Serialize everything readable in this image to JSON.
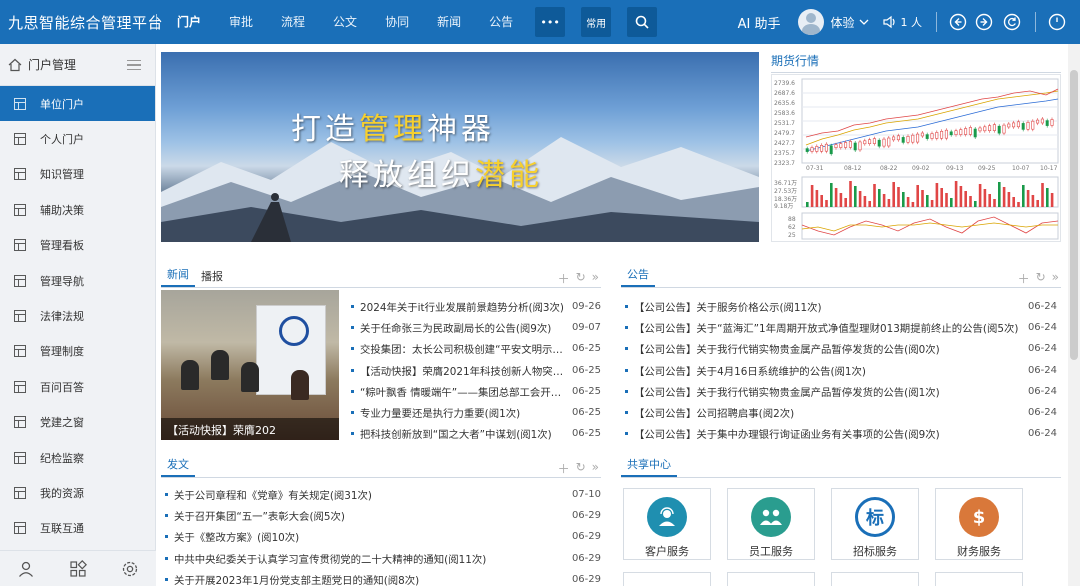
{
  "app": {
    "title": "九思智能综合管理平台"
  },
  "nav": {
    "items": [
      "门户",
      "审批",
      "流程",
      "公文",
      "协同",
      "新闻",
      "公告"
    ],
    "more_label": "•••",
    "common_label": "常用"
  },
  "topbar": {
    "ai_label": "AI 助手",
    "user_name": "体验",
    "online_count": "1 人"
  },
  "sidebar": {
    "header": "门户管理",
    "items": [
      "单位门户",
      "个人门户",
      "知识管理",
      "辅助决策",
      "管理看板",
      "管理导航",
      "法律法规",
      "管理制度",
      "百问百答",
      "党建之窗",
      "纪检监察",
      "我的资源",
      "互联互通"
    ]
  },
  "banner": {
    "line1_a": "打造",
    "line1_b": "管理",
    "line1_c": "神器",
    "line2_a": "释放组织",
    "line2_b": "潜能"
  },
  "futures": {
    "title": "期货行情"
  },
  "news": {
    "tabs": [
      "新闻",
      "播报"
    ],
    "image_caption": "【活动快报】荣膺202",
    "items": [
      {
        "title": "2024年关于it行业发展前景趋势分析(阅3次)",
        "date": "09-26"
      },
      {
        "title": "关于任命张三为民政副局长的公告(阅9次)",
        "date": "09-07"
      },
      {
        "title": "交投集团：太长公司积极创建“平安文明示范...",
        "date": "06-25"
      },
      {
        "title": "【活动快报】荣膺2021年科技创新人物突出贡...",
        "date": "06-25"
      },
      {
        "title": "“粽叶飘香 情暖端午”——集团总部工会开展...",
        "date": "06-25"
      },
      {
        "title": "专业力量要还是执行力重要(阅1次)",
        "date": "06-25"
      },
      {
        "title": "把科技创新放到“国之大者”中谋划(阅1次)",
        "date": "06-25"
      }
    ]
  },
  "notice": {
    "title": "公告",
    "items": [
      {
        "title": "【公司公告】关于服务价格公示(阅11次)",
        "date": "06-24"
      },
      {
        "title": "【公司公告】关于“蓝海汇”1年周期开放式净值型理财013期提前终止的公告(阅5次)",
        "date": "06-24"
      },
      {
        "title": "【公司公告】关于我行代销实物贵金属产品暂停发货的公告(阅0次)",
        "date": "06-24"
      },
      {
        "title": "【公司公告】关于4月16日系统维护的公告(阅1次)",
        "date": "06-24"
      },
      {
        "title": "【公司公告】关于我行代销实物贵金属产品暂停发货的公告(阅1次)",
        "date": "06-24"
      },
      {
        "title": "【公司公告】公司招聘启事(阅2次)",
        "date": "06-24"
      },
      {
        "title": "【公司公告】关于集中办理银行询证函业务有关事项的公告(阅9次)",
        "date": "06-24"
      }
    ]
  },
  "post": {
    "title": "发文",
    "items": [
      {
        "title": "关于公司章程和《党章》有关规定(阅31次)",
        "date": "07-10"
      },
      {
        "title": "关于召开集团“五一”表彰大会(阅5次)",
        "date": "06-29"
      },
      {
        "title": "关于《整改方案》(阅10次)",
        "date": "06-29"
      },
      {
        "title": "中共中央纪委关于认真学习宣传贯彻党的二十大精神的通知(阅11次)",
        "date": "06-29"
      },
      {
        "title": "关于开展2023年1月份党支部主题党日的通知(阅8次)",
        "date": "06-29"
      }
    ]
  },
  "share": {
    "title": "共享中心",
    "cards": [
      {
        "label": "客户服务",
        "color": "#1f8fb0",
        "icon": "customer-service-icon"
      },
      {
        "label": "员工服务",
        "color": "#2a9d8f",
        "icon": "staff-service-icon"
      },
      {
        "label": "招标服务",
        "color": "#1a6fb8",
        "icon": "bidding-service-icon",
        "glyph": "标"
      },
      {
        "label": "财务服务",
        "color": "#d9783a",
        "icon": "finance-service-icon",
        "glyph": "$"
      }
    ]
  },
  "colors": {
    "primary": "#1a6fb8",
    "sidebar_bg": "#f0f2f5"
  }
}
